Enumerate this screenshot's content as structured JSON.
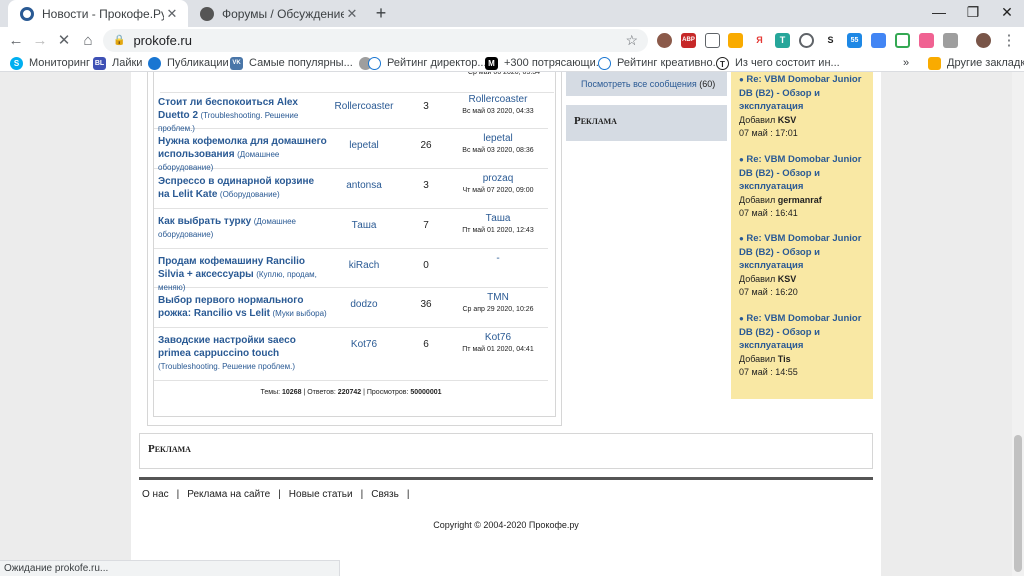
{
  "browser": {
    "tabs": [
      {
        "title": "Новости - Прокофе.Ру - Кофе ф",
        "active": true
      },
      {
        "title": "Форумы / Обсуждение сайта / С",
        "active": false
      }
    ],
    "new_tab": "+",
    "window_controls": {
      "minimize": "—",
      "restore": "❐",
      "close": "✕"
    },
    "url": "prokofe.ru",
    "extension_badges": {
      "abp": "ABP",
      "count": "2",
      "ya": "Я",
      "t": "T",
      "s": "S",
      "badge55": "55"
    },
    "bookmarks": [
      {
        "label": "Мониторинг",
        "icon": "S"
      },
      {
        "label": "Лайки",
        "icon": "BL"
      },
      {
        "label": "Публикации",
        "icon": ""
      },
      {
        "label": "Самые популярны...",
        "icon": "VK"
      },
      {
        "label": "Рейтинг директор...",
        "icon": ""
      },
      {
        "label": "+300 потрясающи...",
        "icon": "M"
      },
      {
        "label": "Рейтинг креативно...",
        "icon": ""
      },
      {
        "label": "Из чего состоит ин...",
        "icon": "T"
      }
    ],
    "bookmarks_more": "»",
    "other_bookmarks": "Другие закладки",
    "status": "Ожидание prokofe.ru..."
  },
  "forum": {
    "partial_date": "Ср май 06 2020, 05:34",
    "rows": [
      {
        "title": "Стоит ли беспокоиться Alex Duetto 2",
        "category": "(Troubleshooting. Решение проблем.)",
        "author": "Rollercoaster",
        "replies": "3",
        "last_user": "Rollercoaster",
        "last_date": "Вс май 03 2020, 04:33"
      },
      {
        "title": "Нужна кофемолка для домашнего использования",
        "category": "(Домашнее оборудование)",
        "author": "lepetal",
        "replies": "26",
        "last_user": "lepetal",
        "last_date": "Вс май 03 2020, 08:36"
      },
      {
        "title": "Эспрессо в одинарной корзине на Lelit Kate",
        "category": "(Оборудование)",
        "author": "antonsa",
        "replies": "3",
        "last_user": "prozaq",
        "last_date": "Чт май 07 2020, 09:00"
      },
      {
        "title": "Как выбрать турку",
        "category": "(Домашнее оборудование)",
        "author": "Таша",
        "replies": "7",
        "last_user": "Таша",
        "last_date": "Пт май 01 2020, 12:43"
      },
      {
        "title": "Продам кофемашину Rancilio Silvia + аксессуары",
        "category": "(Куплю, продам, меняю)",
        "author": "kiRach",
        "replies": "0",
        "last_user": "-",
        "last_date": ""
      },
      {
        "title": "Выбор первого нормального рожка: Rancilio vs Lelit",
        "category": "(Муки выбора)",
        "author": "dodzo",
        "replies": "36",
        "last_user": "TMN",
        "last_date": "Ср апр 29 2020, 10:26"
      },
      {
        "title": "Заводские настройки saeco primea cappuccino touch",
        "category": "(Troubleshooting. Решение проблем.)",
        "author": "Kot76",
        "replies": "6",
        "last_user": "Kot76",
        "last_date": "Пт май 01 2020, 04:41"
      }
    ],
    "stats": {
      "topics_label": "Темы:",
      "topics": "10268",
      "replies_label": "Ответов:",
      "replies": "220742",
      "views_label": "Просмотров:",
      "views": "50000001"
    }
  },
  "middle": {
    "view_all": "Посмотреть все сообщения",
    "view_all_count": "(60)",
    "ad_label": "Реклама"
  },
  "latest_posts": [
    {
      "bullet": "●",
      "title": "Re: VBM Domobar Junior DB (B2) - Обзор и эксплуатация",
      "added_label": "Добавил",
      "user": "KSV",
      "date": "07 май : 17:01"
    },
    {
      "bullet": "●",
      "title": "Re: VBM Domobar Junior DB (B2) - Обзор и эксплуатация",
      "added_label": "Добавил",
      "user": "germanraf",
      "date": "07 май : 16:41"
    },
    {
      "bullet": "●",
      "title": "Re: VBM Domobar Junior DB (B2) - Обзор и эксплуатация",
      "added_label": "Добавил",
      "user": "KSV",
      "date": "07 май : 16:20"
    },
    {
      "bullet": "●",
      "title": "Re: VBM Domobar Junior DB (B2) - Обзор и эксплуатация",
      "added_label": "Добавил",
      "user": "Tis",
      "date": "07 май : 14:55"
    }
  ],
  "bottom_ad": "Реклама",
  "footer": {
    "links": [
      "О нас",
      "Реклама на сайте",
      "Новые статьи",
      "Связь"
    ],
    "separator": "|",
    "copyright": "Copyright © 2004-2020 Прокофе.ру"
  }
}
